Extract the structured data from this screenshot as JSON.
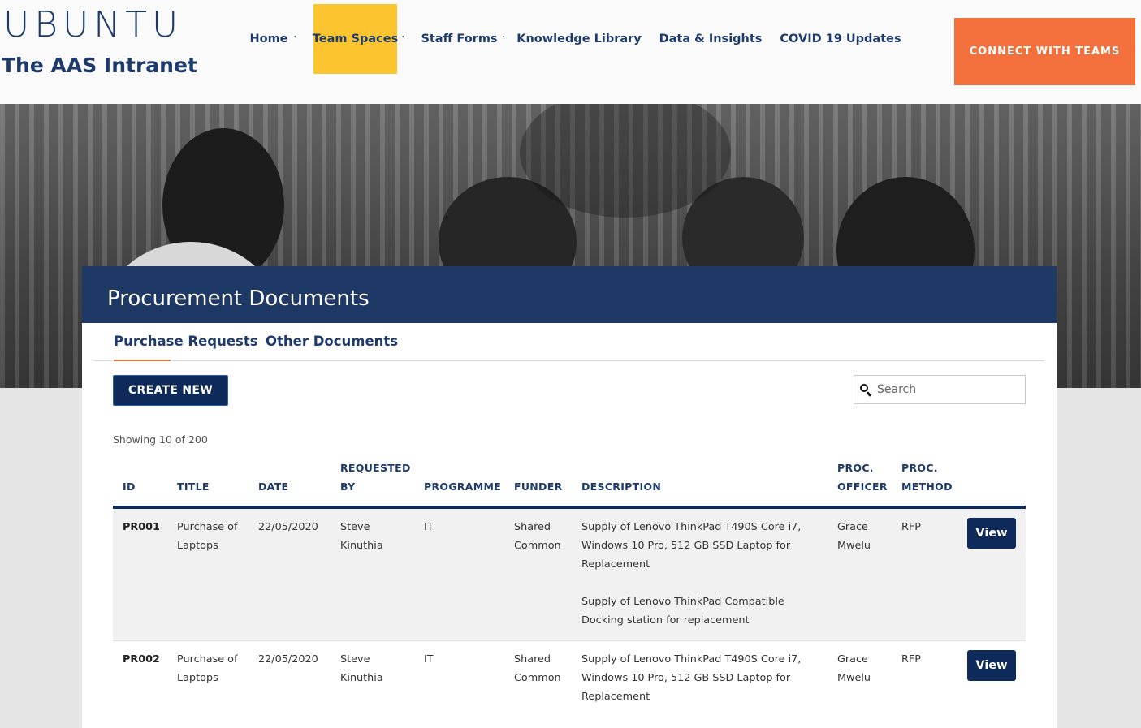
{
  "brand": {
    "logo_text": "UBUNTU",
    "site_title": "The AAS Intranet"
  },
  "nav": {
    "items": [
      {
        "label": "Home"
      },
      {
        "label": "Team Spaces",
        "active": true
      },
      {
        "label": "Staff Forms"
      },
      {
        "label": "Knowledge Library"
      },
      {
        "label": "Data & Insights"
      },
      {
        "label": "COVID 19 Updates"
      }
    ],
    "separator": "·",
    "cta_label": "CONNECT WITH TEAMS"
  },
  "page": {
    "title": "Procurement Documents",
    "tabs": [
      {
        "label": "Purchase Requests",
        "active": true
      },
      {
        "label": "Other Documents"
      }
    ],
    "create_label": "CREATE NEW",
    "search_placeholder": "Search",
    "showing_text": "Showing 10 of 200"
  },
  "table": {
    "headers": {
      "id": "ID",
      "title": "TITLE",
      "date": "DATE",
      "requested_by_1": "REQUESTED",
      "requested_by_2": "BY",
      "programme": "PROGRAMME",
      "funder": "FUNDER",
      "description": "DESCRIPTION",
      "proc_officer_1": "PROC.",
      "proc_officer_2": "OFFICER",
      "proc_method_1": "PROC.",
      "proc_method_2": "METHOD"
    },
    "rows": [
      {
        "id": "PR001",
        "title_1": "Purchase of",
        "title_2": "Laptops",
        "date": "22/05/2020",
        "requested_by_1": "Steve",
        "requested_by_2": "Kinuthia",
        "programme": "IT",
        "funder_1": "Shared",
        "funder_2": "Common",
        "desc_1": "Supply of Lenovo ThinkPad T490S Core i7,",
        "desc_2": "Windows 10 Pro, 512 GB SSD Laptop for",
        "desc_3": "Replacement",
        "desc_4": "Supply of Lenovo ThinkPad Compatible",
        "desc_5": "Docking station for replacement",
        "officer_1": "Grace",
        "officer_2": "Mwelu",
        "method": "RFP",
        "action": "View"
      },
      {
        "id": "PR002",
        "title_1": "Purchase of",
        "title_2": "Laptops",
        "date": "22/05/2020",
        "requested_by_1": "Steve",
        "requested_by_2": "Kinuthia",
        "programme": "IT",
        "funder_1": "Shared",
        "funder_2": "Common",
        "desc_1": "Supply of Lenovo ThinkPad T490S Core i7,",
        "desc_2": "Windows 10 Pro, 512 GB SSD Laptop for",
        "desc_3": "Replacement",
        "officer_1": "Grace",
        "officer_2": "Mwelu",
        "method": "RFP",
        "action": "View"
      }
    ]
  },
  "colors": {
    "brand_navy": "#1d3a6b",
    "dark_navy": "#0e2a5a",
    "active_nav": "#fcc52f",
    "cta_orange": "#f3703c"
  }
}
